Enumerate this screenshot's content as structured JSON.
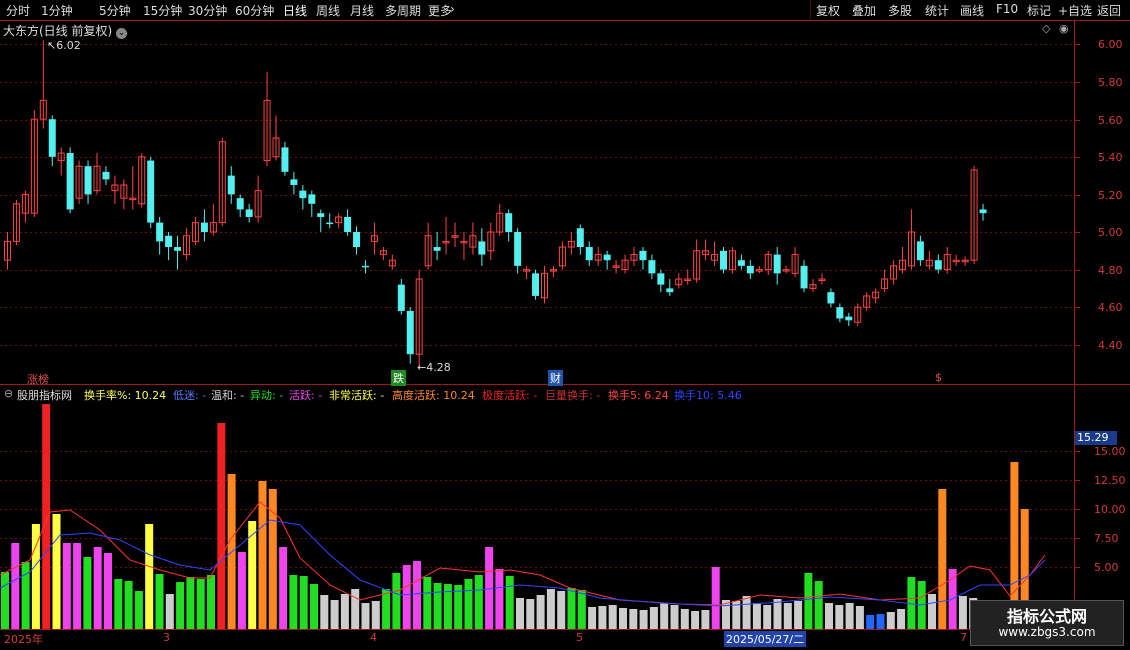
{
  "toolbar": {
    "periods": [
      "分时",
      "1分钟",
      "5分钟",
      "15分钟",
      "30分钟",
      "60分钟",
      "日线",
      "周线",
      "月线",
      "多周期",
      "更多"
    ],
    "active": "日线",
    "right": [
      "复权",
      "叠加",
      "多股",
      "统计",
      "画线",
      "F10",
      "标记",
      "+自选",
      "返回"
    ]
  },
  "main": {
    "title": "大东方(日线 前复权)",
    "price_ticks": [
      "6.00",
      "5.80",
      "5.60",
      "5.40",
      "5.20",
      "5.00",
      "4.80",
      "4.60",
      "4.40"
    ],
    "high_label": "6.02",
    "low_label": "4.28",
    "markers": [
      {
        "text": "涨榜",
        "color": "#e05050"
      },
      {
        "text": "跌",
        "color": "#ffffff",
        "bg": "#1f8a1f"
      },
      {
        "text": "财",
        "color": "#ffffff",
        "bg": "#2255aa"
      },
      {
        "text": "$",
        "color": "#e05050"
      }
    ]
  },
  "indicator": {
    "name": "股朋指标网",
    "turnover_label": "换手率%: 10.24",
    "items": [
      {
        "text": "低迷: -",
        "color": "#5577ff"
      },
      {
        "text": "温和: -",
        "color": "#cccccc"
      },
      {
        "text": "异动: -",
        "color": "#22dd22"
      },
      {
        "text": "活跃: -",
        "color": "#ee44ee"
      },
      {
        "text": "非常活跃: -",
        "color": "#ffff44"
      },
      {
        "text": "高度活跃: 10.24",
        "color": "#ff8822"
      },
      {
        "text": "极度活跃: -",
        "color": "#ee2222"
      },
      {
        "text": "巨量换手: -",
        "color": "#cc3333"
      },
      {
        "text": "换手5: 6.24",
        "color": "#ff4444"
      },
      {
        "text": "换手10: 5.46",
        "color": "#3344ff"
      }
    ],
    "ticks": [
      "15.00",
      "12.50",
      "10.00",
      "7.50",
      "5.00"
    ],
    "current_badge": "15.29"
  },
  "dates": [
    "2025年",
    "3",
    "4",
    "5",
    "2025/05/27/二",
    "7"
  ],
  "watermark": {
    "title": "指标公式网",
    "url": "www.zbgs3.com"
  },
  "colors": {
    "up": "#ff4444",
    "down": "#54f0f0",
    "grid": "#6e0f0f",
    "axis": "#a01818"
  }
}
